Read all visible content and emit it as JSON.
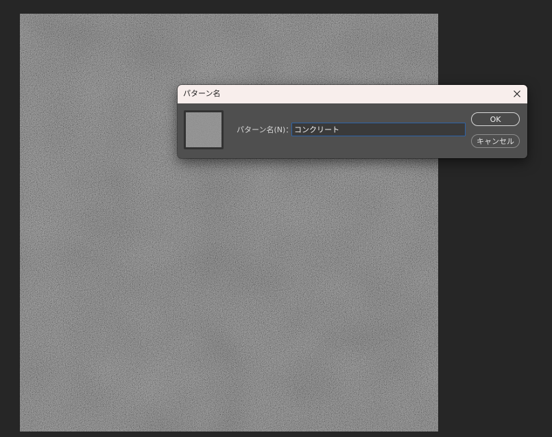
{
  "dialog": {
    "title": "パターン名",
    "field_label": "パターン名(N)：",
    "field_value": "コンクリート",
    "ok_label": "OK",
    "cancel_label": "キャンセル",
    "close_icon": "close-icon"
  },
  "colors": {
    "app_background": "#262626",
    "dialog_body": "#4f4f4f",
    "dialog_titlebar": "#f8eeec",
    "input_focus_border": "#2d63a8",
    "texture_base": "#6a6a6a"
  }
}
